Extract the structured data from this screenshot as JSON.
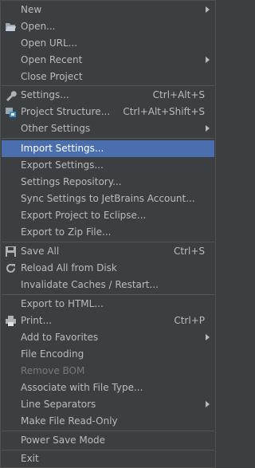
{
  "menu": {
    "new": "New",
    "open": "Open...",
    "open_url": "Open URL...",
    "open_recent": "Open Recent",
    "close_project": "Close Project",
    "settings": "Settings...",
    "settings_shortcut": "Ctrl+Alt+S",
    "project_structure": "Project Structure...",
    "project_structure_shortcut": "Ctrl+Alt+Shift+S",
    "other_settings": "Other Settings",
    "import_settings": "Import Settings...",
    "export_settings": "Export Settings...",
    "settings_repository": "Settings Repository...",
    "sync_settings": "Sync Settings to JetBrains Account...",
    "export_eclipse": "Export Project to Eclipse...",
    "export_zip": "Export to Zip File...",
    "save_all": "Save All",
    "save_all_shortcut": "Ctrl+S",
    "reload_all": "Reload All from Disk",
    "invalidate_caches": "Invalidate Caches / Restart...",
    "export_html": "Export to HTML...",
    "print": "Print...",
    "print_shortcut": "Ctrl+P",
    "add_favorites": "Add to Favorites",
    "file_encoding": "File Encoding",
    "remove_bom": "Remove BOM",
    "associate_file_type": "Associate with File Type...",
    "line_separators": "Line Separators",
    "make_read_only": "Make File Read-Only",
    "power_save": "Power Save Mode",
    "exit": "Exit"
  },
  "colors": {
    "background": "#3c3f41",
    "selection": "#4b6eaf",
    "text": "#bbbbbb",
    "disabled_text": "#787878",
    "separator": "#555555"
  }
}
